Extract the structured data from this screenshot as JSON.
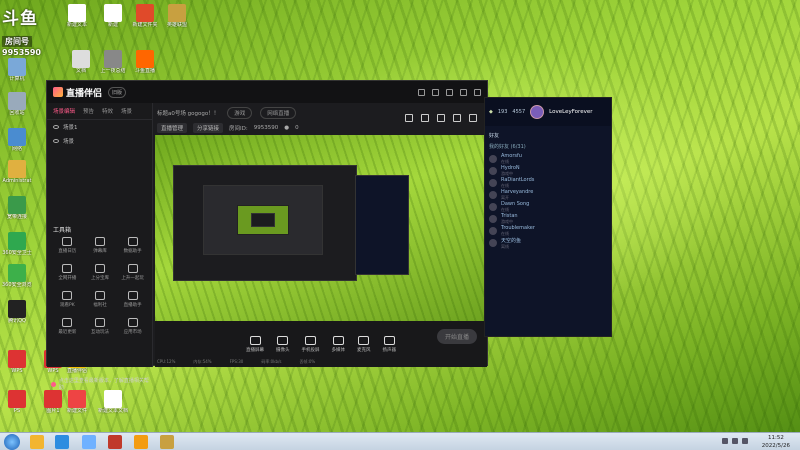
{
  "watermark": {
    "logo": "斗鱼",
    "room_label": "房间号",
    "room_id": "9953590"
  },
  "desktop_icons": [
    {
      "label": "计算机",
      "color": "#7aa8d8"
    },
    {
      "label": "回收站",
      "color": "#9ab"
    },
    {
      "label": "网络",
      "color": "#4a8cd0"
    },
    {
      "label": "Administrat",
      "color": "#e0b040"
    },
    {
      "label": "宽带连接",
      "color": "#3a9a4a"
    },
    {
      "label": "360安全卫士",
      "color": "#2fa84f"
    },
    {
      "label": "360安全浏览器",
      "color": "#3db04a"
    },
    {
      "label": "腾讯QQ",
      "color": "#222"
    },
    {
      "label": "WPS",
      "color": "#d33"
    },
    {
      "label": "PS",
      "color": "#d33"
    },
    {
      "label": "WPS",
      "color": "#d33"
    },
    {
      "label": "图片1",
      "color": "#d33"
    },
    {
      "label": "新建文件",
      "color": "#e44"
    },
    {
      "label": "新建文本文档",
      "color": "#fff"
    },
    {
      "label": "直播伴侣",
      "color": "#f4c000"
    },
    {
      "label": "新建文本",
      "color": "#fff"
    },
    {
      "label": "新建",
      "color": "#fff"
    },
    {
      "label": "新建文件夹",
      "color": "#e04a2a"
    },
    {
      "label": "上一夜总结",
      "color": "#888"
    },
    {
      "label": "斗鱼直播",
      "color": "#f60"
    },
    {
      "label": "英雄联盟",
      "color": "#c8a040"
    },
    {
      "label": "文档",
      "color": "#ddd"
    }
  ],
  "app": {
    "name": "直播伴侣",
    "badge": "旧版",
    "room_title": "标题a0号场 gogogo！！",
    "category_btn": "游戏",
    "mode_btn": "网络直播",
    "manage_btn": "直播管理",
    "edit_btn": "分享链接",
    "room_prefix": "房间ID:",
    "room_id": "9953590",
    "viewer_count": "0",
    "tabs": [
      "场景编辑",
      "预告",
      "特效",
      "场景"
    ],
    "scenes": [
      "场景1",
      "场景"
    ],
    "tools_title": "工具箱",
    "tools": [
      "直播日历",
      "弹幕库",
      "数据助手",
      "全网开播",
      "上分宝库",
      "上升一起玩",
      "观看PK",
      "福利社",
      "直播助手",
      "最近更新",
      "互动玩法",
      "应用市场"
    ],
    "notice": "点击这里查看最新版本，了解直播相关帮助",
    "bottom_buttons": [
      "直播屏幕",
      "摄像头",
      "手机投屏",
      "多媒体",
      "麦克风",
      "扬声器"
    ],
    "start_live": "开始直播",
    "status_items": [
      "CPU:12%",
      "内存:54%",
      "FPS:30",
      "码率:0kb/s",
      "丢帧:0%"
    ]
  },
  "side_panel": {
    "username": "LoveLeyForever",
    "level": "193",
    "points": "4557",
    "tab": "好友",
    "group": "我的好友 (6/31)",
    "friends": [
      {
        "name": "Amorsfu",
        "status": "在线"
      },
      {
        "name": "HydroN",
        "status": "游戏中"
      },
      {
        "name": "RaDiantLords",
        "status": "在线"
      },
      {
        "name": "Harveyandre",
        "status": "离开"
      },
      {
        "name": "Dawn Song",
        "status": "在线"
      },
      {
        "name": "Tristan",
        "status": "游戏中"
      },
      {
        "name": "Troublemaker",
        "status": "在线"
      },
      {
        "name": "天空的鱼",
        "status": "离线"
      }
    ]
  },
  "taskbar": {
    "time": "11:52",
    "date": "2022/5/26"
  }
}
